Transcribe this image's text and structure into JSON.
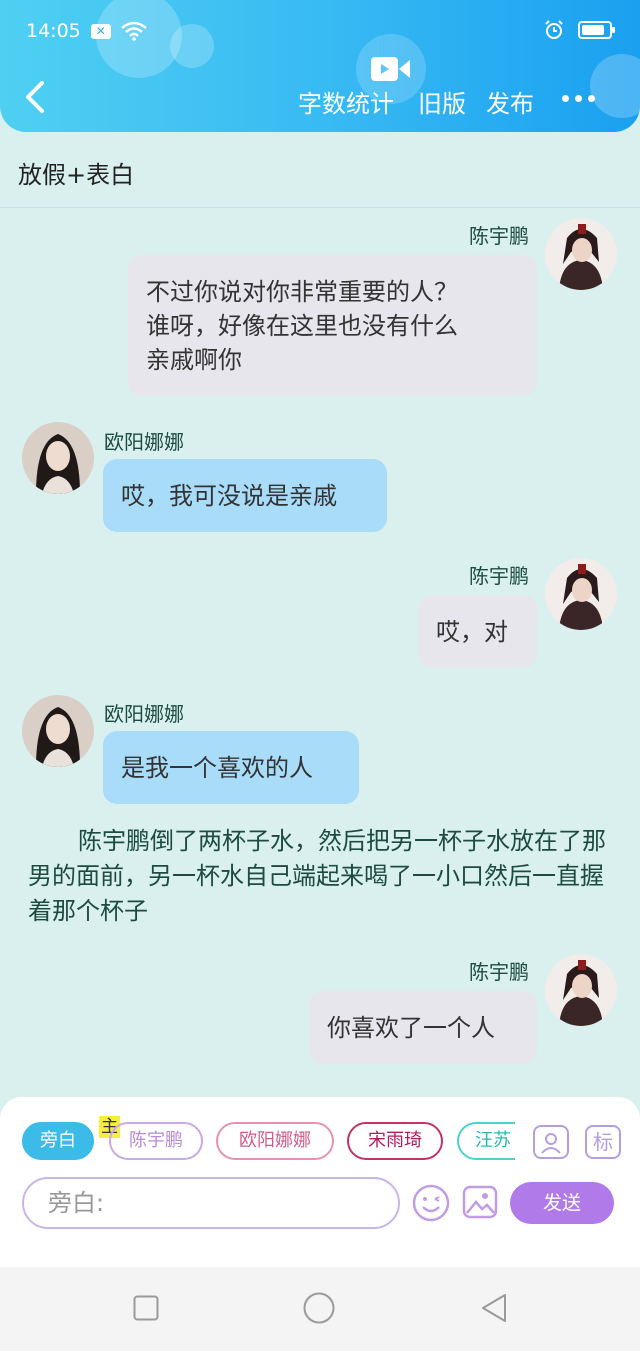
{
  "status_bar": {
    "time": "14:05",
    "battery_level": 0.85
  },
  "header": {
    "nav": [
      "字数统计",
      "旧版",
      "发布"
    ],
    "colors": {
      "primary": "#36b8f3",
      "accent": "#b07be8"
    }
  },
  "story_title": "放假+表白",
  "messages": [
    {
      "speaker": "陈宇鹏",
      "side": "right",
      "text": [
        "不过你说对你非常重要的人？",
        "谁呀，好像在这里也没有什么",
        "亲戚啊你"
      ]
    },
    {
      "speaker": "欧阳娜娜",
      "side": "left",
      "text": [
        "哎，我可没说是亲戚"
      ]
    },
    {
      "speaker": "陈宇鹏",
      "side": "right",
      "text": [
        "哎，对"
      ]
    },
    {
      "speaker": "欧阳娜娜",
      "side": "left",
      "text": [
        "是我一个喜欢的人"
      ]
    },
    {
      "speaker": "陈宇鹏",
      "side": "right",
      "text": [
        "你喜欢了一个人"
      ]
    }
  ],
  "narration": "陈宇鹏倒了两杯子水，然后把另一杯子水放在了那男的面前，另一杯水自己端起来喝了一小口然后一直握着那个杯子",
  "composer": {
    "characters": [
      "旁白",
      "陈宇鹏",
      "欧阳娜娜",
      "宋雨琦",
      "汪苏"
    ],
    "main_tag": "主",
    "tag_button": "标",
    "input_placeholder": "旁白:",
    "send_label": "发送"
  }
}
